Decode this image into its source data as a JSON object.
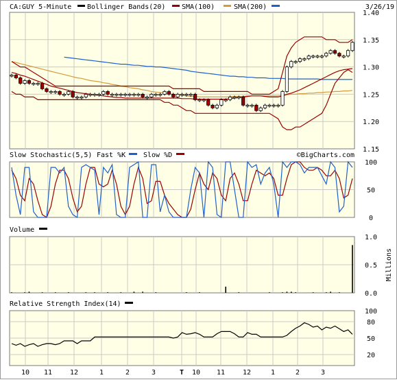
{
  "header": {
    "symbol_label": "CA:GUY 5-Minute",
    "bollinger_label": "Bollinger Bands(20)",
    "sma100_label": "SMA(100)",
    "sma200_label": "SMA(200)",
    "date": "3/26/19"
  },
  "stoch_header": {
    "title": "Slow Stochastic(5,5)",
    "fast_label": "Fast %K",
    "slow_label": "Slow %D",
    "watermark": "©BigCharts.com"
  },
  "volume_header": {
    "title": "Volume",
    "unit": "Millions"
  },
  "rsi_header": {
    "title": "Relative Strength Index(14)"
  },
  "colors": {
    "panel_bg": "#ffffe6",
    "grid": "#c8c8c8",
    "bollinger": "#990000",
    "sma100": "#990000",
    "sma200": "#d49a3a",
    "blue_line": "#1f5fcc",
    "candle_up": "#ffffff",
    "candle_down": "#990000"
  },
  "x_axis": {
    "labels": [
      "10",
      "11",
      "12",
      "1",
      "2",
      "3",
      "T",
      "10",
      "11",
      "12",
      "1",
      "2",
      "3"
    ]
  },
  "chart_data": [
    {
      "type": "candlestick",
      "name": "price",
      "y_ticks": [
        "1.40",
        "1.35",
        "1.30",
        "1.25",
        "1.20",
        "1.15"
      ],
      "ylim": [
        1.15,
        1.4
      ],
      "close": [
        1.285,
        1.28,
        1.27,
        1.275,
        1.27,
        1.27,
        1.27,
        1.26,
        1.255,
        1.255,
        1.255,
        1.25,
        1.25,
        1.255,
        1.245,
        1.245,
        1.245,
        1.25,
        1.25,
        1.25,
        1.25,
        1.255,
        1.25,
        1.25,
        1.25,
        1.25,
        1.25,
        1.25,
        1.25,
        1.25,
        1.245,
        1.245,
        1.25,
        1.25,
        1.25,
        1.255,
        1.25,
        1.245,
        1.25,
        1.25,
        1.25,
        1.25,
        1.24,
        1.24,
        1.24,
        1.23,
        1.225,
        1.23,
        1.24,
        1.24,
        1.245,
        1.245,
        1.245,
        1.23,
        1.23,
        1.23,
        1.22,
        1.225,
        1.23,
        1.23,
        1.23,
        1.23,
        1.255,
        1.3,
        1.31,
        1.31,
        1.315,
        1.315,
        1.32,
        1.32,
        1.32,
        1.32,
        1.325,
        1.33,
        1.325,
        1.32,
        1.32,
        1.33,
        1.345
      ],
      "bollinger_upper": [
        1.31,
        1.305,
        1.3,
        1.3,
        1.295,
        1.29,
        1.285,
        1.28,
        1.275,
        1.27,
        1.265,
        1.265,
        1.265,
        1.265,
        1.265,
        1.265,
        1.265,
        1.265,
        1.265,
        1.265,
        1.265,
        1.265,
        1.265,
        1.265,
        1.265,
        1.265,
        1.265,
        1.265,
        1.265,
        1.265,
        1.265,
        1.265,
        1.265,
        1.265,
        1.265,
        1.265,
        1.265,
        1.26,
        1.26,
        1.26,
        1.26,
        1.26,
        1.26,
        1.26,
        1.255,
        1.255,
        1.255,
        1.255,
        1.255,
        1.255,
        1.255,
        1.255,
        1.255,
        1.255,
        1.255,
        1.25,
        1.25,
        1.25,
        1.25,
        1.25,
        1.255,
        1.26,
        1.29,
        1.32,
        1.335,
        1.345,
        1.35,
        1.355,
        1.355,
        1.355,
        1.355,
        1.355,
        1.35,
        1.35,
        1.35,
        1.345,
        1.345,
        1.345,
        1.35
      ],
      "bollinger_lower": [
        1.255,
        1.25,
        1.25,
        1.245,
        1.245,
        1.245,
        1.24,
        1.24,
        1.24,
        1.24,
        1.24,
        1.24,
        1.24,
        1.24,
        1.24,
        1.24,
        1.24,
        1.24,
        1.24,
        1.24,
        1.24,
        1.24,
        1.24,
        1.24,
        1.24,
        1.24,
        1.24,
        1.24,
        1.24,
        1.24,
        1.24,
        1.24,
        1.24,
        1.24,
        1.24,
        1.235,
        1.235,
        1.23,
        1.23,
        1.225,
        1.22,
        1.22,
        1.215,
        1.215,
        1.215,
        1.215,
        1.215,
        1.215,
        1.215,
        1.215,
        1.215,
        1.215,
        1.215,
        1.215,
        1.215,
        1.215,
        1.215,
        1.215,
        1.215,
        1.215,
        1.21,
        1.205,
        1.19,
        1.185,
        1.185,
        1.19,
        1.19,
        1.195,
        1.2,
        1.205,
        1.21,
        1.215,
        1.23,
        1.25,
        1.27,
        1.28,
        1.29,
        1.295,
        1.29
      ],
      "sma100": [
        1.29,
        1.288,
        1.285,
        1.283,
        1.28,
        1.277,
        1.274,
        1.271,
        1.268,
        1.265,
        1.263,
        1.261,
        1.259,
        1.257,
        1.255,
        1.253,
        1.252,
        1.251,
        1.25,
        1.249,
        1.248,
        1.247,
        1.246,
        1.245,
        1.244,
        1.244,
        1.243,
        1.243,
        1.243,
        1.243,
        1.243,
        1.243,
        1.243,
        1.243,
        1.243,
        1.243,
        1.243,
        1.243,
        1.243,
        1.242,
        1.242,
        1.242,
        1.241,
        1.241,
        1.241,
        1.241,
        1.241,
        1.241,
        1.241,
        1.241,
        1.242,
        1.243,
        1.244,
        1.245,
        1.246,
        1.247,
        1.247,
        1.247,
        1.246,
        1.245,
        1.245,
        1.245,
        1.247,
        1.25,
        1.252,
        1.255,
        1.258,
        1.262,
        1.266,
        1.27,
        1.274,
        1.278,
        1.282,
        1.286,
        1.29,
        1.293,
        1.295,
        1.296,
        1.297
      ],
      "sma200": [
        1.31,
        1.308,
        1.306,
        1.304,
        1.302,
        1.3,
        1.298,
        1.296,
        1.294,
        1.292,
        1.29,
        1.288,
        1.286,
        1.284,
        1.282,
        1.28,
        1.279,
        1.277,
        1.275,
        1.274,
        1.273,
        1.271,
        1.27,
        1.268,
        1.267,
        1.265,
        1.264,
        1.262,
        1.261,
        1.26,
        1.258,
        1.257,
        1.255,
        1.254,
        1.253,
        1.252,
        1.251,
        1.25,
        1.249,
        1.248,
        1.247,
        1.246,
        1.246,
        1.245,
        1.245,
        1.245,
        1.245,
        1.245,
        1.245,
        1.245,
        1.245,
        1.246,
        1.246,
        1.246,
        1.247,
        1.247,
        1.247,
        1.247,
        1.247,
        1.247,
        1.247,
        1.247,
        1.248,
        1.249,
        1.25,
        1.25,
        1.251,
        1.251,
        1.252,
        1.252,
        1.253,
        1.253,
        1.254,
        1.254,
        1.255,
        1.255,
        1.256,
        1.256,
        1.257
      ],
      "blue_line": [
        null,
        null,
        null,
        null,
        null,
        null,
        null,
        null,
        null,
        null,
        null,
        null,
        1.318,
        1.317,
        1.316,
        1.315,
        1.314,
        1.313,
        1.312,
        1.311,
        1.31,
        1.309,
        1.308,
        1.307,
        1.306,
        1.305,
        1.305,
        1.304,
        1.303,
        1.303,
        1.302,
        1.301,
        1.301,
        1.3,
        1.3,
        1.299,
        1.298,
        1.297,
        1.296,
        1.295,
        1.294,
        1.292,
        1.291,
        1.29,
        1.289,
        1.288,
        1.287,
        1.286,
        1.285,
        1.284,
        1.283,
        1.283,
        1.282,
        1.282,
        1.281,
        1.281,
        1.28,
        1.28,
        1.28,
        1.279,
        1.279,
        1.279,
        1.279,
        1.278,
        1.278,
        1.278,
        1.278,
        1.278,
        1.278,
        1.278,
        1.278,
        1.277,
        1.277,
        1.277,
        1.277,
        1.277,
        1.277,
        1.277,
        1.277
      ]
    },
    {
      "type": "line",
      "name": "slow-stochastic",
      "y_ticks": [
        "100",
        "50",
        "0"
      ],
      "ylim": [
        0,
        100
      ],
      "series": [
        {
          "name": "Fast %K",
          "values": [
            90,
            40,
            5,
            90,
            90,
            10,
            0,
            0,
            0,
            90,
            90,
            80,
            90,
            20,
            5,
            0,
            90,
            95,
            90,
            85,
            5,
            90,
            80,
            95,
            5,
            0,
            0,
            90,
            95,
            100,
            0,
            0,
            95,
            95,
            10,
            40,
            10,
            0,
            0,
            0,
            0,
            50,
            90,
            80,
            0,
            100,
            90,
            5,
            0,
            100,
            100,
            50,
            0,
            0,
            100,
            90,
            95,
            60,
            80,
            90,
            60,
            0,
            100,
            90,
            100,
            100,
            95,
            80,
            90,
            90,
            90,
            75,
            60,
            100,
            90,
            10,
            20,
            100,
            90
          ]
        },
        {
          "name": "Slow %D",
          "values": [
            85,
            70,
            40,
            30,
            70,
            60,
            30,
            5,
            0,
            20,
            60,
            85,
            85,
            70,
            35,
            10,
            20,
            60,
            90,
            90,
            60,
            55,
            60,
            85,
            60,
            20,
            5,
            20,
            60,
            90,
            70,
            25,
            30,
            65,
            65,
            40,
            25,
            15,
            5,
            0,
            0,
            15,
            50,
            80,
            60,
            50,
            80,
            70,
            40,
            30,
            70,
            80,
            60,
            30,
            30,
            60,
            85,
            80,
            75,
            80,
            70,
            40,
            40,
            70,
            95,
            100,
            100,
            90,
            85,
            85,
            90,
            85,
            75,
            75,
            85,
            70,
            35,
            40,
            70
          ]
        }
      ]
    },
    {
      "type": "bar",
      "name": "volume",
      "y_ticks": [
        "1.0",
        "0.5",
        "0.0"
      ],
      "ylim": [
        0,
        1.0
      ],
      "values": [
        0.01,
        0.0,
        0.0,
        0.01,
        0.02,
        0.0,
        0.0,
        0.01,
        0.0,
        0.0,
        0.01,
        0.0,
        0.0,
        0.01,
        0.0,
        0.0,
        0.0,
        0.01,
        0.0,
        0.01,
        0.0,
        0.0,
        0.01,
        0.0,
        0.0,
        0.01,
        0.0,
        0.0,
        0.02,
        0.0,
        0.02,
        0.0,
        0.0,
        0.01,
        0.0,
        0.0,
        0.0,
        0.0,
        0.0,
        0.0,
        0.01,
        0.0,
        0.0,
        0.01,
        0.0,
        0.0,
        0.0,
        0.0,
        0.0,
        0.11,
        0.0,
        0.0,
        0.01,
        0.0,
        0.0,
        0.0,
        0.0,
        0.0,
        0.0,
        0.01,
        0.0,
        0.0,
        0.01,
        0.02,
        0.02,
        0.01,
        0.0,
        0.0,
        0.0,
        0.01,
        0.0,
        0.0,
        0.01,
        0.02,
        0.0,
        0.01,
        0.0,
        0.0,
        0.85
      ]
    },
    {
      "type": "line",
      "name": "rsi",
      "y_ticks": [
        "100",
        "80",
        "50",
        "20"
      ],
      "ylim": [
        0,
        100
      ],
      "values": [
        40,
        37,
        40,
        35,
        38,
        40,
        35,
        38,
        40,
        40,
        38,
        40,
        45,
        45,
        45,
        40,
        45,
        45,
        45,
        52,
        52,
        52,
        52,
        52,
        52,
        52,
        52,
        52,
        52,
        52,
        52,
        52,
        52,
        52,
        52,
        52,
        52,
        50,
        52,
        60,
        57,
        58,
        60,
        57,
        52,
        52,
        52,
        58,
        62,
        62,
        62,
        58,
        52,
        52,
        60,
        57,
        57,
        52,
        52,
        52,
        52,
        52,
        52,
        55,
        62,
        68,
        72,
        78,
        75,
        70,
        72,
        65,
        70,
        68,
        72,
        67,
        62,
        65,
        57
      ]
    }
  ]
}
